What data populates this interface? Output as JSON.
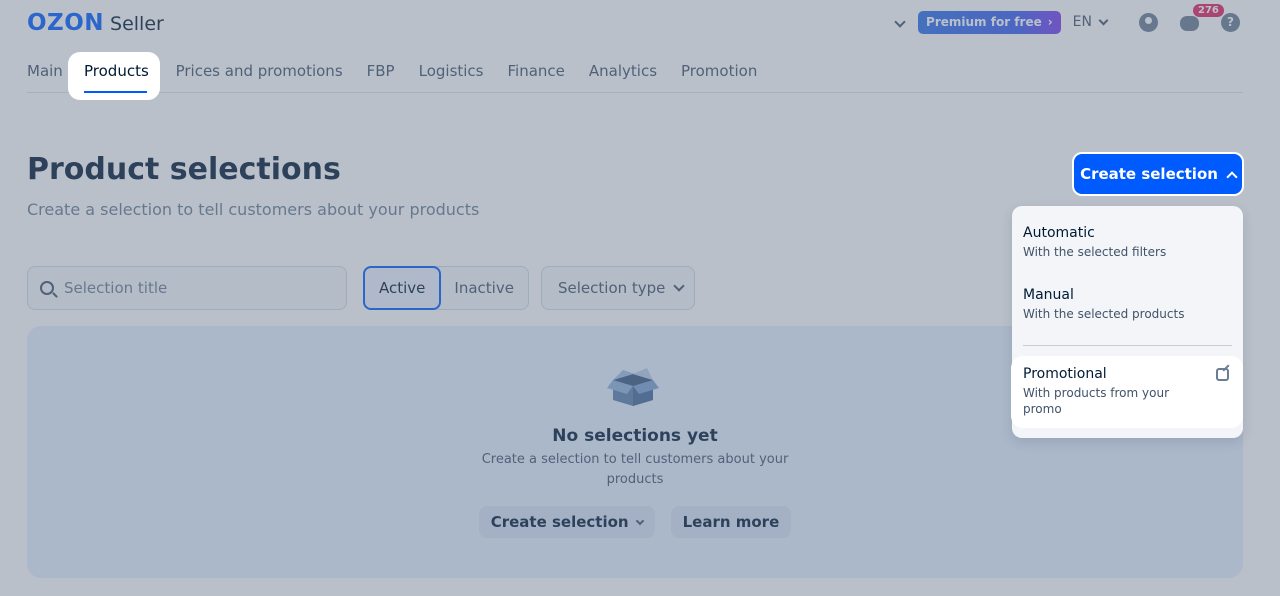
{
  "header": {
    "logo_brand": "OZON",
    "logo_product": "Seller",
    "premium_label": "Premium for free",
    "language": "EN",
    "notifications_count": "276",
    "help_glyph": "?"
  },
  "tabs": [
    {
      "label": "Main"
    },
    {
      "label": "Products"
    },
    {
      "label": "Prices and promotions"
    },
    {
      "label": "FBP"
    },
    {
      "label": "Logistics"
    },
    {
      "label": "Finance"
    },
    {
      "label": "Analytics"
    },
    {
      "label": "Promotion"
    }
  ],
  "page": {
    "title": "Product selections",
    "subtitle": "Create a selection to tell customers about your products",
    "create_button": "Create selection"
  },
  "filters": {
    "search_placeholder": "Selection title",
    "status_active": "Active",
    "status_inactive": "Inactive",
    "type_select": "Selection type"
  },
  "empty_state": {
    "title": "No selections yet",
    "text": "Create a selection to tell customers about your products",
    "create_button": "Create selection",
    "learn_more": "Learn more"
  },
  "dropdown": {
    "items": [
      {
        "title": "Automatic",
        "desc": "With the selected filters"
      },
      {
        "title": "Manual",
        "desc": "With the selected products"
      },
      {
        "title": "Promotional",
        "desc": "With products from your promo"
      }
    ]
  },
  "colors": {
    "accent": "#005bff",
    "badge": "#e31f5e",
    "overlay": "#64748a"
  }
}
